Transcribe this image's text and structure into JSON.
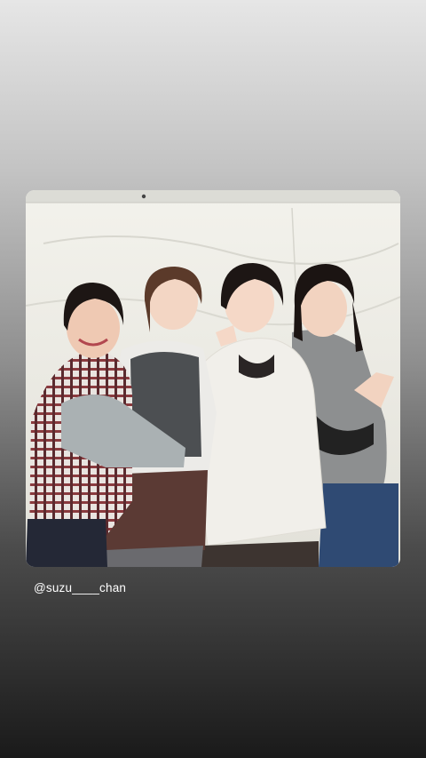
{
  "story": {
    "mention": "@suzu____chan"
  },
  "photo": {
    "subject": "group-photo"
  }
}
